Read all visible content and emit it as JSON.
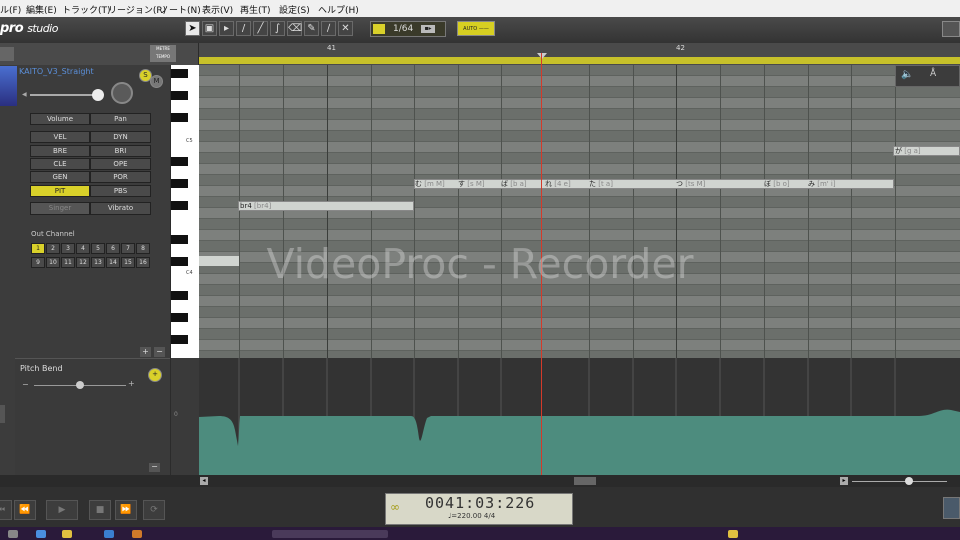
{
  "menubar": {
    "items": [
      "ル(F)",
      "編集(E)",
      "トラック(T)",
      "リージョン(R)",
      "ノート(N)",
      "表示(V)",
      "再生(T)",
      "設定(S)",
      "ヘルプ(H)"
    ]
  },
  "app": {
    "logo_main": "pro",
    "logo_sub": "studio"
  },
  "toolbar": {
    "quantize_value": "1/64",
    "quantize_dropdown": "▪▸",
    "auto_label": "AUTO ——",
    "meter_tempo_label": "METRE TEMPO"
  },
  "track": {
    "singer_name": "KAITO_V3_Straight"
  },
  "parameters": {
    "volume_label": "Volume",
    "pan_label": "Pan",
    "rows": [
      [
        "VEL",
        "DYN"
      ],
      [
        "BRE",
        "BRI"
      ],
      [
        "CLE",
        "OPE"
      ],
      [
        "GEN",
        "POR"
      ],
      [
        "PIT",
        "PBS"
      ]
    ],
    "singer_button": "Singer",
    "vibrato_button": "Vibrato",
    "out_channel_label": "Out Channel",
    "channels": [
      "1",
      "2",
      "3",
      "4",
      "5",
      "6",
      "7",
      "8",
      "9",
      "10",
      "11",
      "12",
      "13",
      "14",
      "15",
      "16"
    ],
    "selected_channel": "1",
    "active_param": "PIT"
  },
  "piano": {
    "c5_label": "C5",
    "c4_label": "C4"
  },
  "ruler": {
    "measure_41": "41",
    "measure_42": "42"
  },
  "notes": [
    {
      "lyric": "br4",
      "phoneme": "[br4]"
    },
    {
      "lyric": "む",
      "phoneme": "[m M]"
    },
    {
      "lyric": "す",
      "phoneme": "[s M]"
    },
    {
      "lyric": "ば",
      "phoneme": "[b a]"
    },
    {
      "lyric": "れ",
      "phoneme": "[4 e]"
    },
    {
      "lyric": "た",
      "phoneme": "[t a]"
    },
    {
      "lyric": "つ",
      "phoneme": "[ts M]"
    },
    {
      "lyric": "ぼ",
      "phoneme": "[b o]"
    },
    {
      "lyric": "み",
      "phoneme": "[m' i]"
    },
    {
      "lyric": "が",
      "phoneme": "[g a]"
    }
  ],
  "pitch_bend": {
    "label": "Pitch Bend",
    "zero_label": "0"
  },
  "transport": {
    "timecode": "0041:03:226",
    "tempo": "♩=220.00  4/4"
  },
  "watermark": "VideoProc - Recorder",
  "colors": {
    "accent_yellow": "#d9d12a",
    "playhead_red": "#d43a2a",
    "pitch_fill_teal": "#4d8c7e",
    "singer_name_blue": "#5b8fd8"
  }
}
